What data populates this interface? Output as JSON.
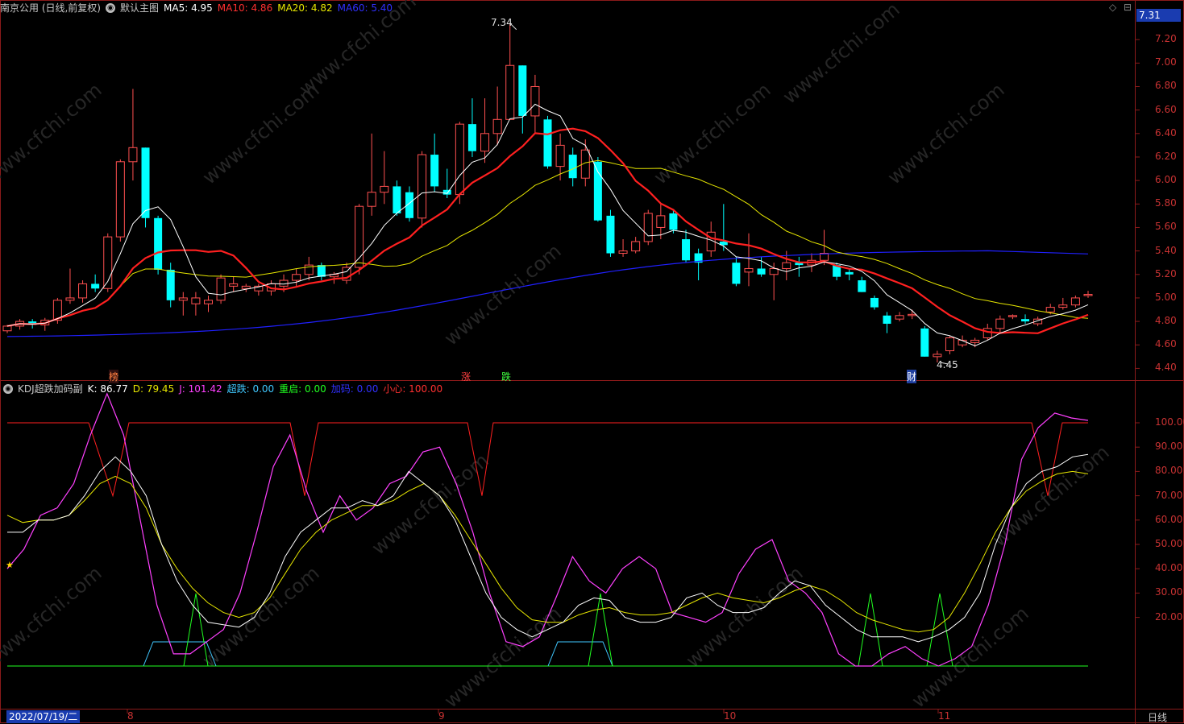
{
  "header": {
    "stock": "南京公用 (日线,前复权)",
    "main_chart": "默认主图",
    "ma5": "MA5: 4.95",
    "ma10": "MA10: 4.86",
    "ma20": "MA20: 4.82",
    "ma60": "MA60: 5.40",
    "current_price_tag": "7.31"
  },
  "sub_header": {
    "title": "KDJ超跌加码副",
    "k": "K: 86.77",
    "d": "D: 79.45",
    "j": "J: 101.42",
    "chaodie": "超跌: 0.00",
    "chongqi": "重启: 0.00",
    "jiama": "加码: 0.00",
    "xiaoxin": "小心: 100.00"
  },
  "price_axis": [
    "7.20",
    "7.00",
    "6.80",
    "6.60",
    "6.40",
    "6.20",
    "6.00",
    "5.80",
    "5.60",
    "5.40",
    "5.20",
    "5.00",
    "4.80",
    "4.60",
    "4.40"
  ],
  "kdj_axis": [
    "100.00",
    "90.00",
    "80.00",
    "70.00",
    "60.00",
    "50.00",
    "40.00",
    "30.00",
    "20.00"
  ],
  "annotations": {
    "high": "7.34",
    "low": "4.45",
    "marker_bang": "榜",
    "marker_zhang": "涨",
    "marker_die": "跌",
    "marker_cai": "财"
  },
  "x_axis": {
    "date": "2022/07/19/二",
    "months": [
      "8",
      "9",
      "10",
      "11"
    ],
    "period": "日线"
  },
  "watermark": "www.cfchi.com",
  "colors": {
    "up": "#ff5050",
    "down": "#00ffff",
    "ma5": "#ffffff",
    "ma10": "#ff2020",
    "ma20": "#e6e600",
    "ma60": "#2020ff",
    "k": "#ffffff",
    "d": "#e6e600",
    "j": "#ff40ff",
    "chaodie": "#40c8ff",
    "chongqi": "#20ff20",
    "xiaoxin": "#ff2020"
  },
  "chart_data": {
    "type": "candlestick",
    "candles": [
      [
        4.72,
        4.77,
        4.7,
        4.76
      ],
      [
        4.76,
        4.82,
        4.73,
        4.8
      ],
      [
        4.8,
        4.82,
        4.74,
        4.77
      ],
      [
        4.77,
        4.83,
        4.72,
        4.81
      ],
      [
        4.81,
        5.0,
        4.78,
        4.98
      ],
      [
        4.98,
        5.25,
        4.95,
        5.0
      ],
      [
        5.0,
        5.15,
        4.96,
        5.12
      ],
      [
        5.12,
        5.2,
        5.05,
        5.08
      ],
      [
        5.08,
        5.55,
        5.05,
        5.52
      ],
      [
        5.52,
        6.18,
        5.48,
        6.16
      ],
      [
        6.16,
        6.78,
        6.0,
        6.28
      ],
      [
        6.28,
        6.05,
        5.6,
        5.68
      ],
      [
        5.68,
        5.7,
        5.2,
        5.24
      ],
      [
        5.24,
        5.3,
        4.92,
        4.98
      ],
      [
        4.98,
        5.05,
        4.85,
        5.0
      ],
      [
        4.95,
        5.05,
        4.85,
        5.0
      ],
      [
        4.95,
        5.02,
        4.88,
        4.98
      ],
      [
        4.98,
        5.2,
        4.95,
        5.17
      ],
      [
        5.1,
        5.18,
        5.05,
        5.12
      ],
      [
        5.08,
        5.12,
        5.05,
        5.1
      ],
      [
        5.06,
        5.12,
        5.02,
        5.1
      ],
      [
        5.06,
        5.15,
        5.02,
        5.12
      ],
      [
        5.1,
        5.2,
        5.05,
        5.15
      ],
      [
        5.15,
        5.25,
        5.1,
        5.2
      ],
      [
        5.2,
        5.35,
        5.15,
        5.28
      ],
      [
        5.28,
        5.3,
        5.15,
        5.18
      ],
      [
        5.18,
        5.22,
        5.12,
        5.2
      ],
      [
        5.15,
        5.3,
        5.12,
        5.26
      ],
      [
        5.26,
        5.8,
        5.2,
        5.78
      ],
      [
        5.78,
        6.4,
        5.7,
        5.9
      ],
      [
        5.9,
        6.25,
        5.8,
        5.95
      ],
      [
        5.95,
        6.0,
        5.7,
        5.72
      ],
      [
        5.9,
        5.95,
        5.65,
        5.68
      ],
      [
        5.68,
        6.25,
        5.6,
        6.22
      ],
      [
        6.22,
        6.4,
        5.9,
        5.95
      ],
      [
        5.92,
        6.1,
        5.85,
        5.88
      ],
      [
        5.88,
        6.5,
        5.8,
        6.48
      ],
      [
        6.48,
        6.7,
        6.2,
        6.25
      ],
      [
        6.25,
        6.7,
        6.15,
        6.4
      ],
      [
        6.4,
        6.8,
        6.3,
        6.52
      ],
      [
        6.52,
        7.34,
        6.75,
        6.98
      ],
      [
        6.98,
        6.7,
        6.4,
        6.55
      ],
      [
        6.55,
        6.9,
        6.4,
        6.8
      ],
      [
        6.52,
        6.55,
        6.1,
        6.12
      ],
      [
        6.12,
        6.4,
        6.0,
        6.3
      ],
      [
        6.22,
        6.28,
        5.95,
        6.02
      ],
      [
        6.02,
        6.35,
        5.95,
        6.26
      ],
      [
        6.16,
        6.2,
        5.65,
        5.66
      ],
      [
        5.7,
        5.75,
        5.35,
        5.38
      ],
      [
        5.38,
        5.5,
        5.35,
        5.4
      ],
      [
        5.4,
        5.52,
        5.38,
        5.48
      ],
      [
        5.48,
        5.75,
        5.45,
        5.72
      ],
      [
        5.6,
        5.8,
        5.5,
        5.7
      ],
      [
        5.72,
        5.75,
        5.55,
        5.58
      ],
      [
        5.5,
        5.58,
        5.3,
        5.32
      ],
      [
        5.38,
        5.42,
        5.15,
        5.3
      ],
      [
        5.4,
        5.65,
        5.35,
        5.56
      ],
      [
        5.48,
        5.8,
        5.4,
        5.45
      ],
      [
        5.3,
        5.35,
        5.1,
        5.12
      ],
      [
        5.22,
        5.55,
        5.1,
        5.25
      ],
      [
        5.25,
        5.35,
        5.18,
        5.2
      ],
      [
        5.2,
        5.3,
        4.98,
        5.25
      ],
      [
        5.25,
        5.4,
        5.15,
        5.3
      ],
      [
        5.3,
        5.35,
        5.18,
        5.28
      ],
      [
        5.28,
        5.38,
        5.22,
        5.32
      ],
      [
        5.32,
        5.58,
        5.28,
        5.38
      ],
      [
        5.28,
        5.3,
        5.15,
        5.18
      ],
      [
        5.22,
        5.25,
        5.15,
        5.2
      ],
      [
        5.15,
        5.18,
        5.05,
        5.05
      ],
      [
        5.0,
        5.02,
        4.9,
        4.92
      ],
      [
        4.85,
        4.88,
        4.7,
        4.78
      ],
      [
        4.82,
        4.88,
        4.8,
        4.85
      ],
      [
        4.85,
        4.9,
        4.82,
        4.86
      ],
      [
        4.74,
        4.76,
        4.5,
        4.5
      ],
      [
        4.5,
        4.55,
        4.45,
        4.52
      ],
      [
        4.55,
        4.68,
        4.52,
        4.66
      ],
      [
        4.6,
        4.68,
        4.58,
        4.64
      ],
      [
        4.62,
        4.66,
        4.58,
        4.64
      ],
      [
        4.66,
        4.78,
        4.64,
        4.74
      ],
      [
        4.74,
        4.85,
        4.7,
        4.82
      ],
      [
        4.84,
        4.86,
        4.82,
        4.85
      ],
      [
        4.82,
        4.86,
        4.78,
        4.8
      ],
      [
        4.78,
        4.84,
        4.76,
        4.82
      ],
      [
        4.88,
        4.95,
        4.86,
        4.92
      ],
      [
        4.92,
        5.0,
        4.9,
        4.94
      ],
      [
        4.94,
        5.02,
        4.92,
        5.0
      ],
      [
        5.02,
        5.06,
        5.0,
        5.03
      ]
    ],
    "kdj": {
      "k": [
        55,
        55,
        60,
        60,
        62,
        70,
        80,
        86,
        80,
        70,
        50,
        35,
        25,
        18,
        17,
        16,
        20,
        30,
        45,
        55,
        60,
        65,
        65,
        68,
        66,
        70,
        80,
        75,
        70,
        60,
        45,
        30,
        20,
        15,
        12,
        15,
        18,
        25,
        28,
        27,
        20,
        18,
        18,
        20,
        28,
        30,
        25,
        22,
        22,
        24,
        30,
        35,
        33,
        25,
        20,
        15,
        12,
        12,
        12,
        10,
        12,
        15,
        20,
        30,
        50,
        65,
        75,
        80,
        82,
        86,
        87
      ],
      "d": [
        62,
        59,
        60,
        60,
        62,
        68,
        75,
        78,
        75,
        65,
        50,
        40,
        32,
        26,
        22,
        20,
        22,
        28,
        38,
        48,
        55,
        60,
        63,
        66,
        66,
        68,
        72,
        75,
        70,
        62,
        52,
        42,
        32,
        24,
        19,
        18,
        18,
        21,
        23,
        24,
        22,
        21,
        21,
        22,
        25,
        28,
        30,
        28,
        27,
        26,
        28,
        31,
        33,
        31,
        27,
        22,
        19,
        17,
        15,
        14,
        15,
        20,
        30,
        42,
        55,
        65,
        72,
        76,
        79,
        80,
        79
      ],
      "j": [
        40,
        48,
        62,
        65,
        75,
        95,
        112,
        95,
        60,
        25,
        5,
        5,
        10,
        15,
        30,
        55,
        82,
        95,
        72,
        55,
        70,
        60,
        65,
        75,
        78,
        88,
        90,
        75,
        55,
        30,
        10,
        8,
        12,
        28,
        45,
        35,
        30,
        40,
        45,
        40,
        22,
        20,
        18,
        22,
        38,
        48,
        52,
        35,
        30,
        22,
        5,
        0,
        0,
        5,
        8,
        3,
        0,
        3,
        8,
        25,
        50,
        85,
        98,
        104,
        102,
        101
      ],
      "xiaoxin": [
        100,
        100,
        100,
        70,
        100,
        100,
        100,
        100,
        100,
        70,
        100,
        100,
        100,
        100,
        100,
        100,
        100,
        100,
        100,
        100,
        100,
        100,
        100,
        70,
        100,
        100
      ]
    }
  }
}
